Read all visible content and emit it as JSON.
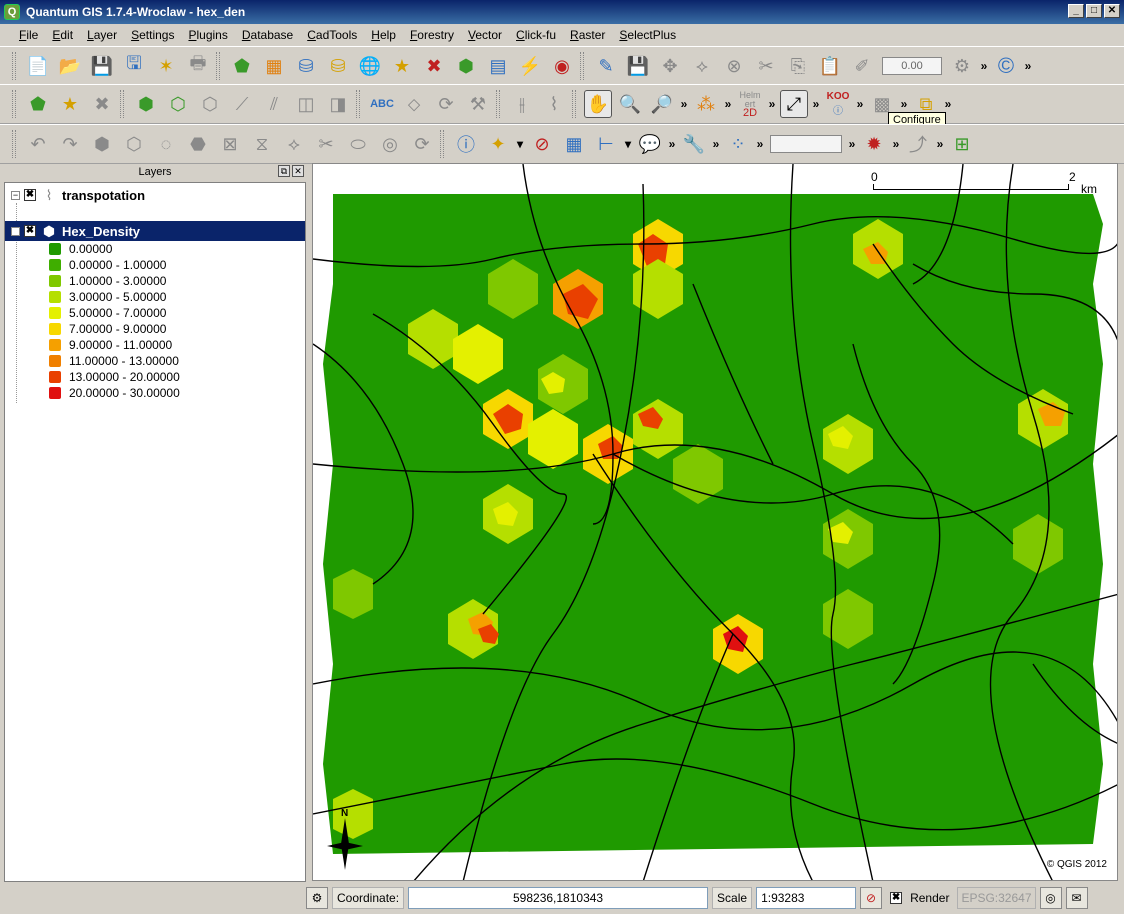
{
  "window": {
    "title": "Quantum GIS 1.7.4-Wroclaw - hex_den",
    "icon": "qgis-icon"
  },
  "menubar": {
    "items": [
      "File",
      "Edit",
      "Layer",
      "Settings",
      "Plugins",
      "Database",
      "CadTools",
      "Help",
      "Forestry",
      "Vector",
      "Click-fu",
      "Raster",
      "SelectPlus"
    ]
  },
  "toolbar": {
    "helmert_label_top": "Helm",
    "helmert_label_mid": "ert",
    "helmert_label_2d": "2D",
    "koo_label": "KOO",
    "units_combo": "0.00",
    "tooltip": "Configure"
  },
  "layers_panel": {
    "title": "Layers",
    "layers": [
      {
        "name": "transpotation",
        "checked": true,
        "selected": false,
        "icon": "line-layer-icon"
      },
      {
        "name": "Hex_Density",
        "checked": true,
        "selected": true,
        "icon": "polygon-layer-icon"
      }
    ],
    "legend": [
      {
        "label": "0.00000",
        "color": "#1f9a00"
      },
      {
        "label": "0.00000 - 1.00000",
        "color": "#3fae00"
      },
      {
        "label": "1.00000 - 3.00000",
        "color": "#7fc800"
      },
      {
        "label": "3.00000 - 5.00000",
        "color": "#b5df00"
      },
      {
        "label": "5.00000 - 7.00000",
        "color": "#e4f000"
      },
      {
        "label": "7.00000 - 9.00000",
        "color": "#f7d800"
      },
      {
        "label": "9.00000 - 11.00000",
        "color": "#f5a000"
      },
      {
        "label": "11.00000 - 13.00000",
        "color": "#f08000"
      },
      {
        "label": "13.00000 - 20.00000",
        "color": "#e94000"
      },
      {
        "label": "20.00000 - 30.00000",
        "color": "#e01010"
      }
    ]
  },
  "map": {
    "scalebar_start": "0",
    "scalebar_end": "2",
    "scalebar_unit": "km",
    "north_label": "N",
    "copyright": "© QGIS 2012"
  },
  "statusbar": {
    "coordinate_label": "Coordinate:",
    "coordinate_value": "598236,1810343",
    "scale_label": "Scale",
    "scale_value": "1:93283",
    "render_label": "Render",
    "epsg": "EPSG:32647"
  }
}
